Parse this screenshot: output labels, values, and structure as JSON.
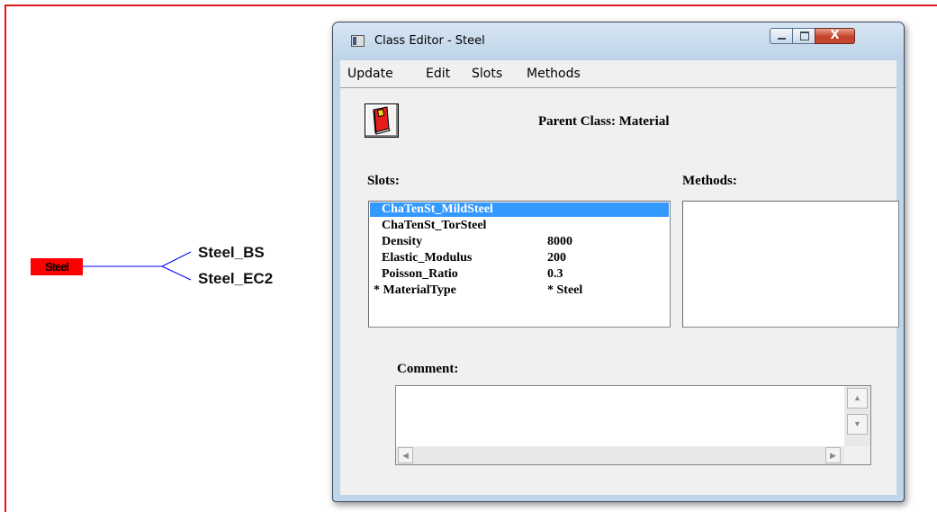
{
  "tree": {
    "root": "Steel",
    "children": [
      "Steel_BS",
      "Steel_EC2"
    ]
  },
  "window": {
    "title": "Class Editor - Steel",
    "close_glyph": "X",
    "menu": [
      "Update",
      "Edit",
      "Slots",
      "Methods"
    ],
    "parent_class_text": "Parent Class:  Material",
    "slots_label": "Slots:",
    "methods_label": "Methods:",
    "comment_label": "Comment:",
    "comment_value": "",
    "slots": [
      {
        "name": "ChaTenSt_MildSteel",
        "value": "",
        "selected": true
      },
      {
        "name": "ChaTenSt_TorSteel",
        "value": "",
        "selected": false
      },
      {
        "name": "Density",
        "value": "8000",
        "selected": false
      },
      {
        "name": "Elastic_Modulus",
        "value": "200",
        "selected": false
      },
      {
        "name": "Poisson_Ratio",
        "value": "0.3",
        "selected": false
      },
      {
        "name": "* MaterialType",
        "value": "* Steel",
        "selected": false
      }
    ],
    "methods": [],
    "icons": {
      "app_icon": "window-icon",
      "parent_button_icon": "red-book-icon",
      "scroll_up": "▲",
      "scroll_down": "▼",
      "scroll_left": "◀",
      "scroll_right": "▶"
    }
  },
  "colors": {
    "frame_red": "#e0191b",
    "root_node": "#ff0000",
    "tree_line": "#0000ff",
    "selection": "#3399ff"
  }
}
